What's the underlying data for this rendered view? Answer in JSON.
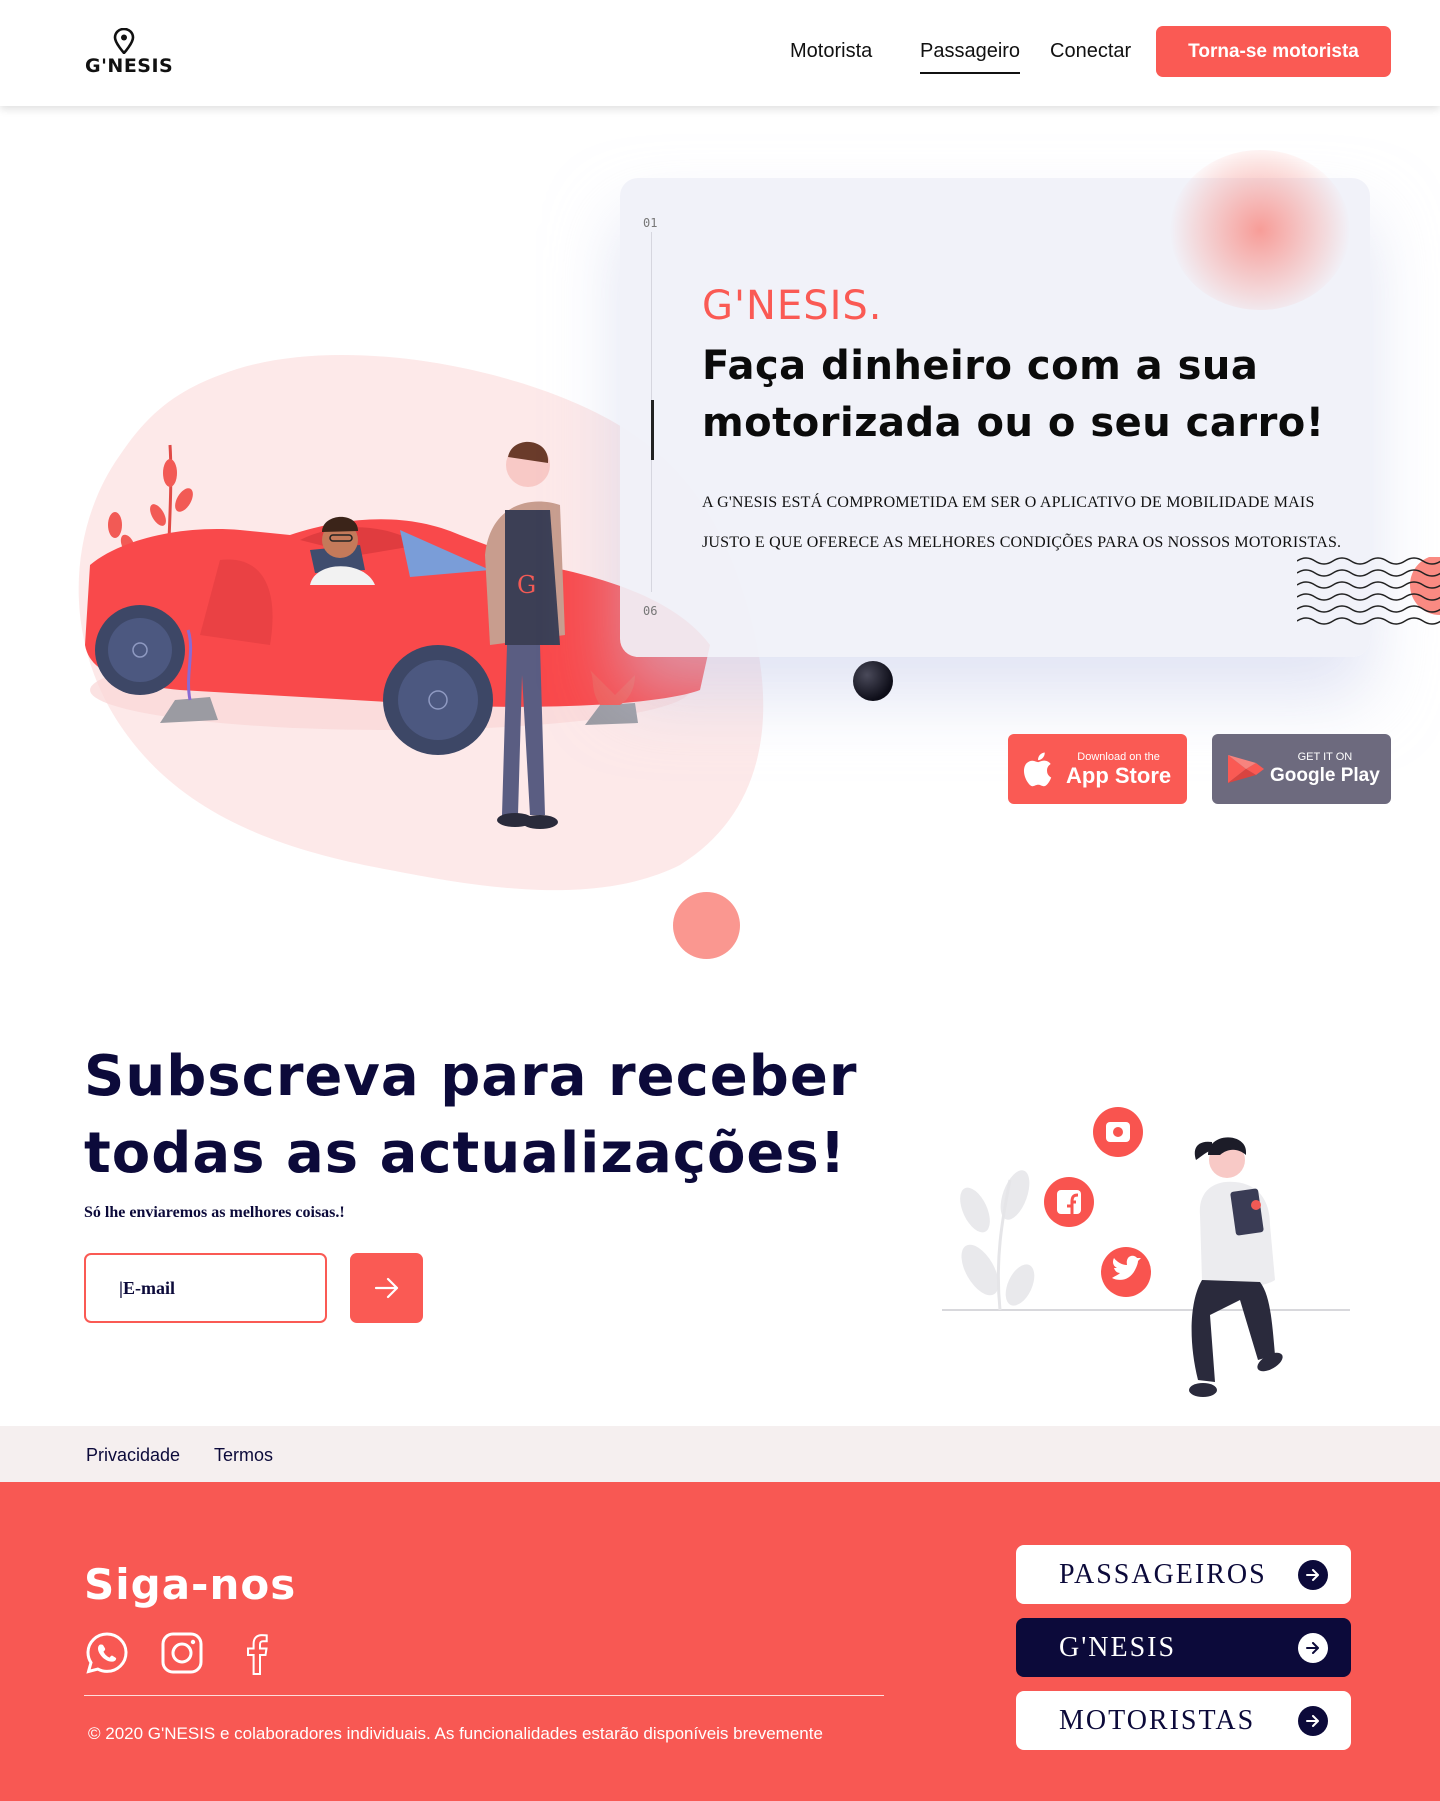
{
  "header": {
    "logo_text": "G'NESIS",
    "nav": [
      {
        "label": "Motorista"
      },
      {
        "label": "Passageiro"
      },
      {
        "label": "Conectar"
      }
    ],
    "cta_label": "Torna-se motorista"
  },
  "hero": {
    "slide_start": "01",
    "slide_end": "06",
    "brand": "G'NESIS.",
    "title": "Faça dinheiro com a sua motorizada ou o seu carro!",
    "description": "A G'NESIS ESTÁ COMPROMETIDA EM SER O APLICATIVO DE MOBILIDADE MAIS JUSTO E QUE OFERECE AS MELHORES CONDIÇÕES PARA OS NOSSOS MOTORISTAS.",
    "apple_small": "Download on the",
    "apple_big": "App Store",
    "google_small": "GET IT ON",
    "google_big": "Google Play"
  },
  "subscribe": {
    "title": "Subscreva para receber todas as actualizações!",
    "subtitle": "Só lhe enviaremos as melhores coisas.!",
    "email_placeholder": "|E-mail"
  },
  "legal": {
    "privacy": "Privacidade",
    "terms": "Termos"
  },
  "footer": {
    "follow_title": "Siga-nos",
    "copyright": "© 2020 G'NESIS e colaboradores individuais.  As funcionalidades estarão  disponíveis brevemente",
    "buttons": [
      {
        "label": "PASSAGEIROS"
      },
      {
        "label": "G'NESIS"
      },
      {
        "label": "MOTORISTAS"
      }
    ]
  },
  "colors": {
    "accent": "#fa5a54",
    "navy": "#0c0a3a",
    "footer_bg": "#f85853",
    "legal_bg": "#f5efef"
  },
  "icons": [
    "location-pin-icon",
    "apple-icon",
    "google-play-icon",
    "arrow-right-icon",
    "instagram-icon",
    "facebook-icon",
    "twitter-icon",
    "whatsapp-icon"
  ]
}
